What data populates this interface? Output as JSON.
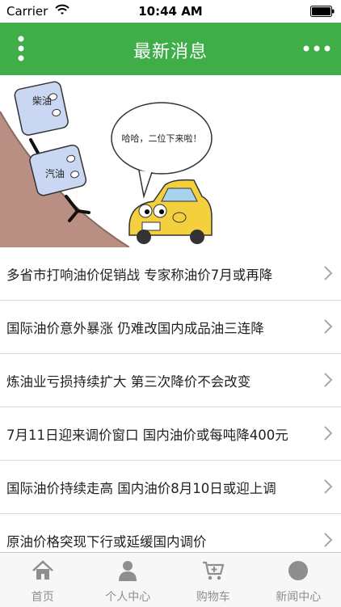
{
  "status_bar": {
    "carrier": "Carrier",
    "time": "10:44 AM"
  },
  "nav": {
    "title": "最新消息"
  },
  "banner": {
    "label_diesel": "柴油",
    "label_gasoline": "汽油",
    "speech": "哈哈，二位下来啦！"
  },
  "news": [
    {
      "title": "多省市打响油价促销战 专家称油价7月或再降"
    },
    {
      "title": "国际油价意外暴涨 仍难改国内成品油三连降"
    },
    {
      "title": "炼油业亏损持续扩大 第三次降价不会改变"
    },
    {
      "title": "7月11日迎来调价窗口 国内油价或每吨降400元"
    },
    {
      "title": "国际油价持续走高 国内油价8月10日或迎上调"
    },
    {
      "title": "原油价格突现下行或延缓国内调价"
    }
  ],
  "tabs": [
    {
      "label": "首页",
      "icon": "home-icon"
    },
    {
      "label": "个人中心",
      "icon": "person-icon"
    },
    {
      "label": "购物车",
      "icon": "cart-icon"
    },
    {
      "label": "新闻中心",
      "icon": "news-icon"
    }
  ],
  "colors": {
    "accent": "#3fae49",
    "tab_inactive": "#8e8e8e"
  }
}
